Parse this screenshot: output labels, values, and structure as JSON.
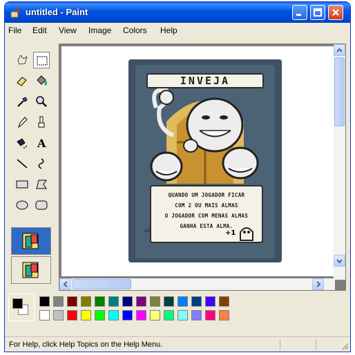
{
  "window": {
    "title": "untitled - Paint"
  },
  "menu": [
    "File",
    "Edit",
    "View",
    "Image",
    "Colors",
    "Help"
  ],
  "tools": [
    "free-form-select",
    "select",
    "eraser",
    "fill-with-color",
    "pick-color",
    "magnifier",
    "pencil",
    "brush",
    "airbrush",
    "text",
    "line",
    "curve",
    "rectangle",
    "polygon",
    "ellipse",
    "rounded-rectangle"
  ],
  "card": {
    "title": "INVEJA",
    "lines": [
      "QUANDO UM JOGADOR FICAR",
      "COM 2 OU MAIS ALMAS",
      "O JOGADOR COM MENAS ALMAS",
      "GANHA ESTA ALMA."
    ],
    "bonus": "+1"
  },
  "palette": {
    "foreground": "#000000",
    "background": "#FFFFFF",
    "row1": [
      "#000000",
      "#808080",
      "#800000",
      "#808000",
      "#008000",
      "#008080",
      "#000080",
      "#800080",
      "#808040",
      "#004040",
      "#0080FF",
      "#004080",
      "#4000FF",
      "#804000"
    ],
    "row2": [
      "#FFFFFF",
      "#C0C0C0",
      "#FF0000",
      "#FFFF00",
      "#00FF00",
      "#00FFFF",
      "#0000FF",
      "#FF00FF",
      "#FFFF80",
      "#00FF80",
      "#80FFFF",
      "#8080FF",
      "#FF0080",
      "#FF8040"
    ]
  },
  "status": {
    "help_text": "For Help, click Help Topics on the Help Menu."
  }
}
